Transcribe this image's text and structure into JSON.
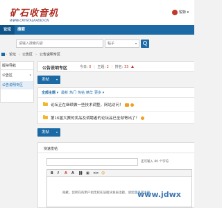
{
  "header": {
    "logo_text": "矿石收音机",
    "logo_url": "WWW.CRYSTALRADIO.CN",
    "user_name": "锐特 ▾"
  },
  "nav": {
    "items": [
      {
        "label": "论坛"
      },
      {
        "label": "搜索"
      }
    ]
  },
  "search": {
    "placeholder": "请输入搜索内容",
    "scope": "帖子",
    "scope_arrow": "▾"
  },
  "breadcrumb": {
    "items": [
      "论坛",
      "公告区",
      "公告说明专区"
    ],
    "separator": "›"
  },
  "sidebar": {
    "header": "版块导航",
    "items": [
      {
        "label": "公告区",
        "arrow": "▾"
      },
      {
        "label": "公告说明专区"
      }
    ]
  },
  "forum": {
    "title": "公告说明专区",
    "today_label": "今日:",
    "today_value": "0",
    "threads_label": "主题:",
    "threads_value": "2",
    "rank_label": "排名:",
    "rank_value": "33"
  },
  "post_button": {
    "label": "发帖",
    "caret": "▾"
  },
  "filters": [
    {
      "label": "全部主题 ▾"
    },
    {
      "label": "最新"
    },
    {
      "label": "热门"
    },
    {
      "label": "热帖"
    },
    {
      "label": "精华"
    },
    {
      "label": "更多 ▾"
    }
  ],
  "threads": [
    {
      "title": "论坛正在继续做一些技术调整，网站访问！"
    },
    {
      "title": "第16届大赛的奖品及调聘者的论坛品已全部寄出了！"
    }
  ],
  "quick_post": {
    "title": "快速发帖",
    "hint": "还可输入 80 个字符",
    "toolbar": [
      "B",
      "I",
      "A",
      "A",
      "⛓",
      "▣",
      "<>",
      "☺"
    ],
    "notice_prefix": "抱歉，您所在的用户组无权在该版块发表话题，请您",
    "notice_link": "登录",
    "notice_mid": "或",
    "notice_link2": "注册"
  },
  "watermark": "www.jdwx"
}
